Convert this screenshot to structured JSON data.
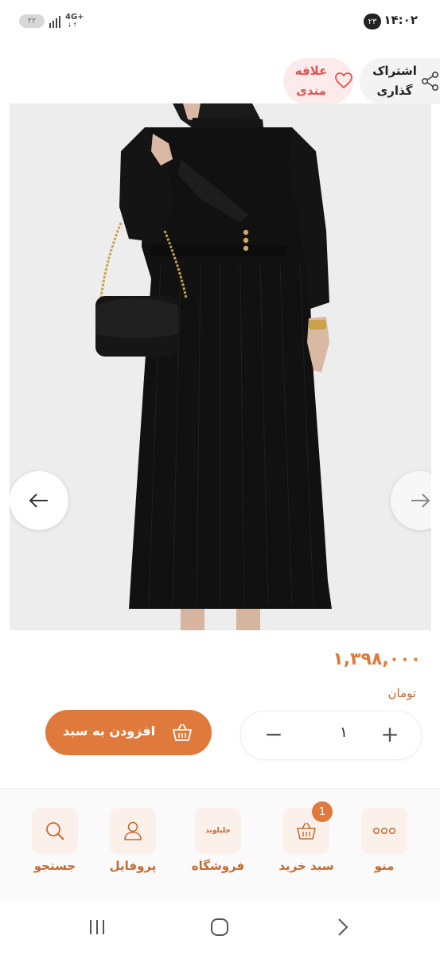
{
  "status_bar": {
    "time": "۱۴:۰۲",
    "notification_count": "۲۳",
    "network": "4G+",
    "battery": "۲۲"
  },
  "actions": {
    "share_label_line1": "اشتراک",
    "share_label_line2": "گذاری",
    "favorite_label_line1": "علاقه",
    "favorite_label_line2": "مندی"
  },
  "product": {
    "price": "۱,۳۹۸,۰۰۰",
    "currency": "تومان",
    "quantity": "۱",
    "add_to_cart_label": "افزودن به سبد"
  },
  "bottom_nav": {
    "items": [
      {
        "label": "منو",
        "icon": "dots-icon"
      },
      {
        "label": "سبد خرید",
        "icon": "basket-icon",
        "badge": "1"
      },
      {
        "label": "فروشگاه",
        "icon": "store-logo",
        "logo_text": "جلیلوند"
      },
      {
        "label": "پروفایل",
        "icon": "user-icon"
      },
      {
        "label": "جستجو",
        "icon": "search-icon"
      }
    ]
  },
  "colors": {
    "accent": "#e07a3c",
    "favorite": "#e0524e",
    "tile_bg": "#fbf1ea"
  }
}
